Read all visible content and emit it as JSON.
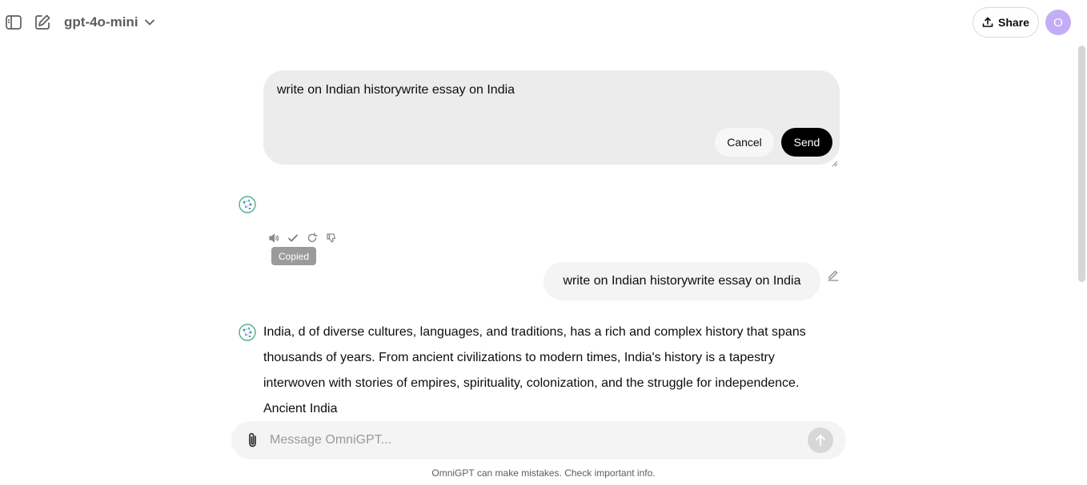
{
  "header": {
    "model_name": "gpt-4o-mini",
    "share_label": "Share",
    "avatar_initial": "O"
  },
  "edit": {
    "text": "write on Indian historywrite essay on India",
    "cancel_label": "Cancel",
    "send_label": "Send"
  },
  "actions": {
    "tooltip": "Copied"
  },
  "user_message": {
    "text": "write on Indian historywrite essay on India"
  },
  "assistant": {
    "lines": [
      "India, d of diverse cultures, languages, and traditions, has a rich and complex history that spans",
      "thousands of years. From ancient civilizations to modern times, India's history is a tapestry",
      "interwoven with stories of empires, spirituality, colonization, and the struggle for independence.",
      "Ancient India"
    ]
  },
  "composer": {
    "placeholder": "Message OmniGPT..."
  },
  "footer": {
    "disclaimer": "OmniGPT can make mistakes. Check important info."
  },
  "colors": {
    "avatar_bg": "#c3aef5",
    "send_button_bg": "#000000",
    "bubble_bg": "#f4f4f4",
    "edit_bg": "#ececec"
  }
}
